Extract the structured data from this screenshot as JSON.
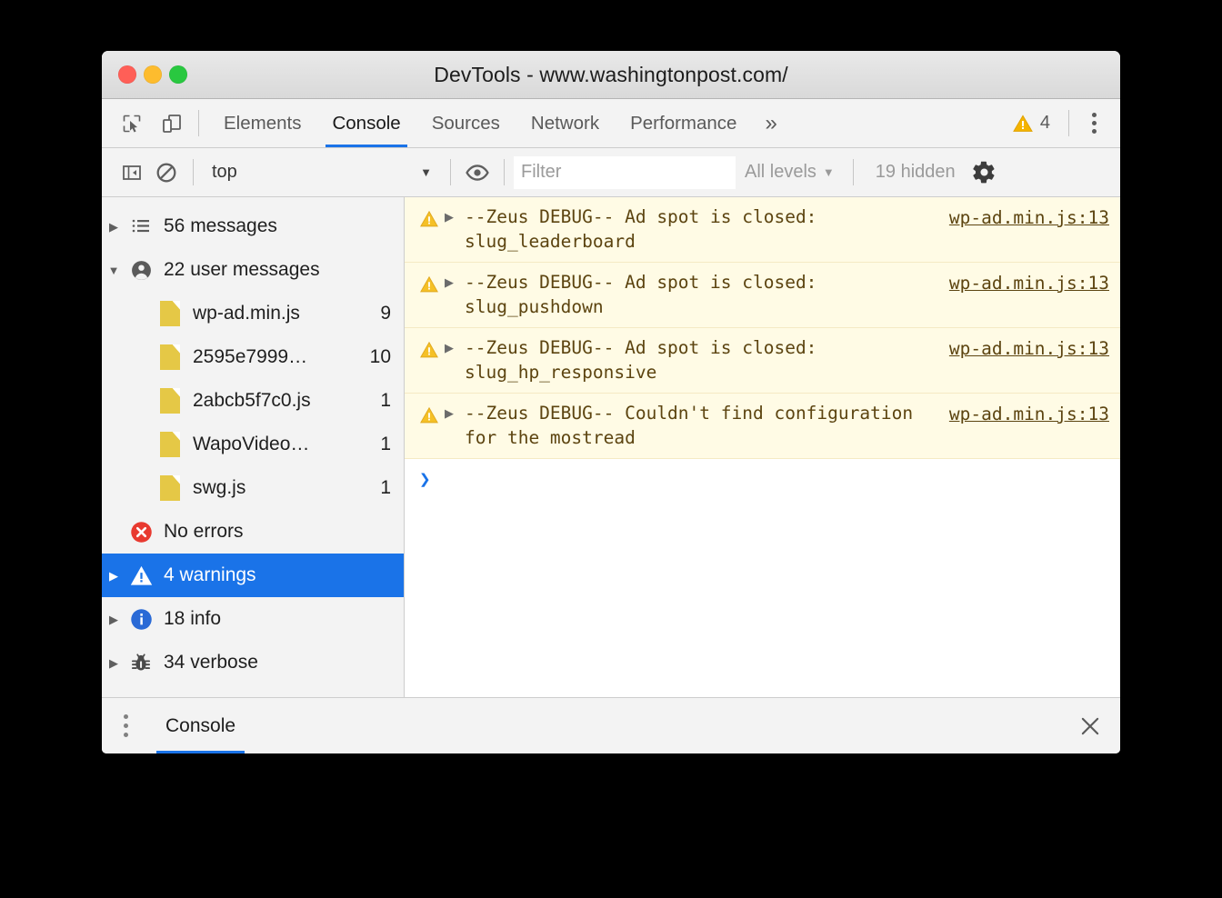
{
  "window": {
    "title": "DevTools - www.washingtonpost.com/",
    "traffic_lights": {
      "close": "close",
      "minimize": "minimize",
      "zoom": "zoom"
    },
    "colors": {
      "accent": "#1a73e8",
      "warning": "#f0b400",
      "error": "#e53935",
      "info": "#2a6ad6",
      "chrome_bg": "#f3f3f3",
      "warn_row_bg": "#fffbe5"
    }
  },
  "tabbar": {
    "inspect_icon": "inspect-element-icon",
    "device_icon": "device-toolbar-icon",
    "tabs": [
      {
        "label": "Elements",
        "active": false
      },
      {
        "label": "Console",
        "active": true
      },
      {
        "label": "Sources",
        "active": false
      },
      {
        "label": "Network",
        "active": false
      },
      {
        "label": "Performance",
        "active": false
      }
    ],
    "more_tabs": "»",
    "warning_count": "4",
    "warning_icon": "warning-triangle-icon",
    "menu_icon": "kebab-menu-icon"
  },
  "filterbar": {
    "sidebar_toggle_icon": "sidebar-toggle-icon",
    "clear_icon": "clear-console-icon",
    "context": "top",
    "context_caret": "▼",
    "eye_icon": "live-expression-eye-icon",
    "filter_placeholder": "Filter",
    "filter_value": "",
    "levels": "All levels",
    "levels_caret": "▼",
    "hidden": "19 hidden",
    "settings_icon": "settings-gear-icon"
  },
  "sidebar": {
    "items": [
      {
        "label": "56 messages",
        "count": "",
        "icon": "list-icon",
        "triangle": "collapsed",
        "indent": false,
        "selected": false
      },
      {
        "label": "22 user messages",
        "count": "",
        "icon": "user-icon",
        "triangle": "expanded",
        "indent": false,
        "selected": false
      },
      {
        "label": "wp-ad.min.js",
        "count": "9",
        "icon": "file-icon",
        "triangle": "none",
        "indent": true,
        "selected": false
      },
      {
        "label": "2595e7999…",
        "count": "10",
        "icon": "file-icon",
        "triangle": "none",
        "indent": true,
        "selected": false
      },
      {
        "label": "2abcb5f7c0.js",
        "count": "1",
        "icon": "file-icon",
        "triangle": "none",
        "indent": true,
        "selected": false
      },
      {
        "label": "WapoVideo…",
        "count": "1",
        "icon": "file-icon",
        "triangle": "none",
        "indent": true,
        "selected": false
      },
      {
        "label": "swg.js",
        "count": "1",
        "icon": "file-icon",
        "triangle": "none",
        "indent": true,
        "selected": false
      },
      {
        "label": "No errors",
        "count": "",
        "icon": "error-icon",
        "triangle": "none",
        "indent": false,
        "selected": false
      },
      {
        "label": "4 warnings",
        "count": "",
        "icon": "warning-icon",
        "triangle": "collapsed",
        "indent": false,
        "selected": true
      },
      {
        "label": "18 info",
        "count": "",
        "icon": "info-icon",
        "triangle": "collapsed",
        "indent": false,
        "selected": false
      },
      {
        "label": "34 verbose",
        "count": "",
        "icon": "bug-icon",
        "triangle": "collapsed",
        "indent": false,
        "selected": false
      }
    ]
  },
  "console": {
    "messages": [
      {
        "level": "warning",
        "text": "--Zeus DEBUG-- Ad spot is closed: slug_leaderboard",
        "source": "wp-ad.min.js:13"
      },
      {
        "level": "warning",
        "text": "--Zeus DEBUG-- Ad spot is closed: slug_pushdown",
        "source": "wp-ad.min.js:13"
      },
      {
        "level": "warning",
        "text": "--Zeus DEBUG-- Ad spot is closed: slug_hp_responsive",
        "source": "wp-ad.min.js:13"
      },
      {
        "level": "warning",
        "text": "--Zeus DEBUG-- Couldn't find configuration for the mostread",
        "source": "wp-ad.min.js:13"
      }
    ],
    "prompt_symbol": "❯"
  },
  "drawer": {
    "menu_icon": "drawer-kebab-icon",
    "tab_label": "Console",
    "close_icon": "close-drawer-icon",
    "close_glyph": "✕"
  }
}
